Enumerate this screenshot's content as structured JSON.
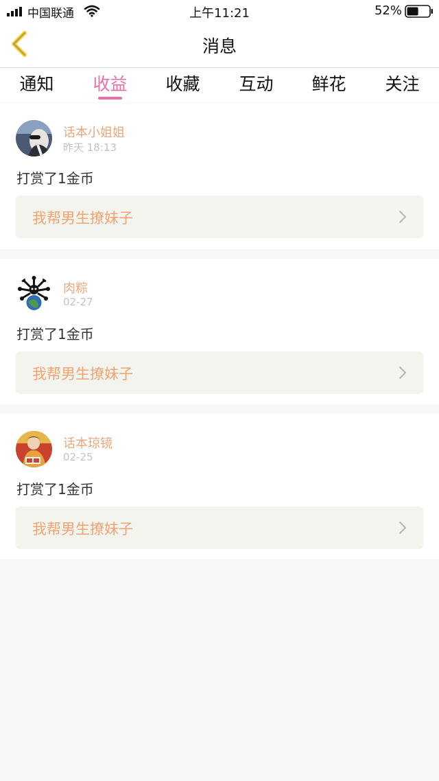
{
  "status_bar": {
    "carrier": "中国联通",
    "time": "上午11:21",
    "battery": "52%",
    "battery_level": 0.52
  },
  "nav": {
    "title": "消息",
    "back_icon": "chevron-left-icon"
  },
  "tabs": [
    {
      "label": "通知",
      "active": false
    },
    {
      "label": "收益",
      "active": true
    },
    {
      "label": "收藏",
      "active": false
    },
    {
      "label": "互动",
      "active": false
    },
    {
      "label": "鲜花",
      "active": false
    },
    {
      "label": "关注",
      "active": false
    }
  ],
  "colors": {
    "accent": "#e96fa6",
    "name": "#e8a87a",
    "story": "#f0a36f",
    "story_bg": "#f4f4ef"
  },
  "messages": [
    {
      "user": "话本小姐姐",
      "time": "昨天 18:13",
      "action": "打赏了1金币",
      "story": "我帮男生撩妹子"
    },
    {
      "user": "肉粽",
      "time": "02-27",
      "action": "打赏了1金币",
      "story": "我帮男生撩妹子"
    },
    {
      "user": "话本琼镜",
      "time": "02-25",
      "action": "打赏了1金币",
      "story": "我帮男生撩妹子"
    }
  ]
}
